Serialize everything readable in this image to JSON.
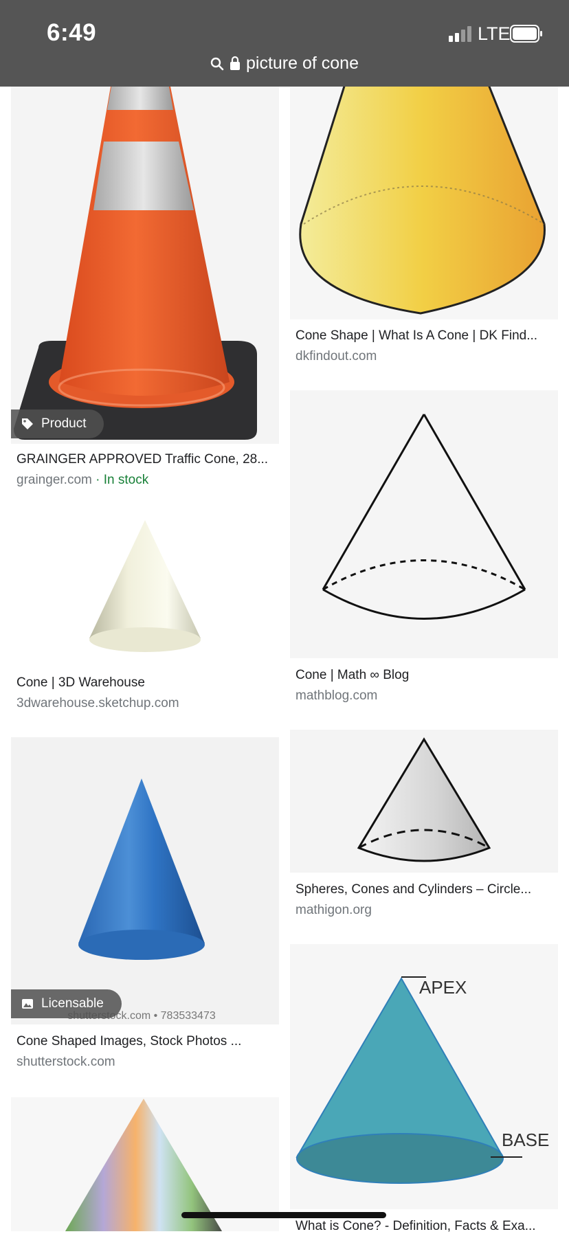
{
  "status": {
    "time": "6:49",
    "network": "LTE"
  },
  "address_bar": {
    "query": "picture of cone"
  },
  "results": [
    {
      "caption": "GRAINGER APPROVED Traffic Cone, 28...",
      "source": "grainger.com",
      "extra": "· In stock",
      "badge": "Product"
    },
    {
      "caption": "Cone Shape | What Is A Cone | DK Find...",
      "source": "dkfindout.com"
    },
    {
      "caption": "Cone | Math ∞ Blog",
      "source": "mathblog.com"
    },
    {
      "caption": "Cone | 3D Warehouse",
      "source": "3dwarehouse.sketchup.com"
    },
    {
      "caption": "Spheres, Cones and Cylinders – Circle...",
      "source": "mathigon.org"
    },
    {
      "caption": "Cone Shaped Images, Stock Photos ...",
      "source": "shutterstock.com",
      "badge": "Licensable",
      "watermark": "shutterstock.com • 783533473"
    },
    {
      "caption": "What is Cone? - Definition, Facts & Exa...",
      "source": "",
      "labels": [
        "APEX",
        "BASE"
      ]
    }
  ]
}
